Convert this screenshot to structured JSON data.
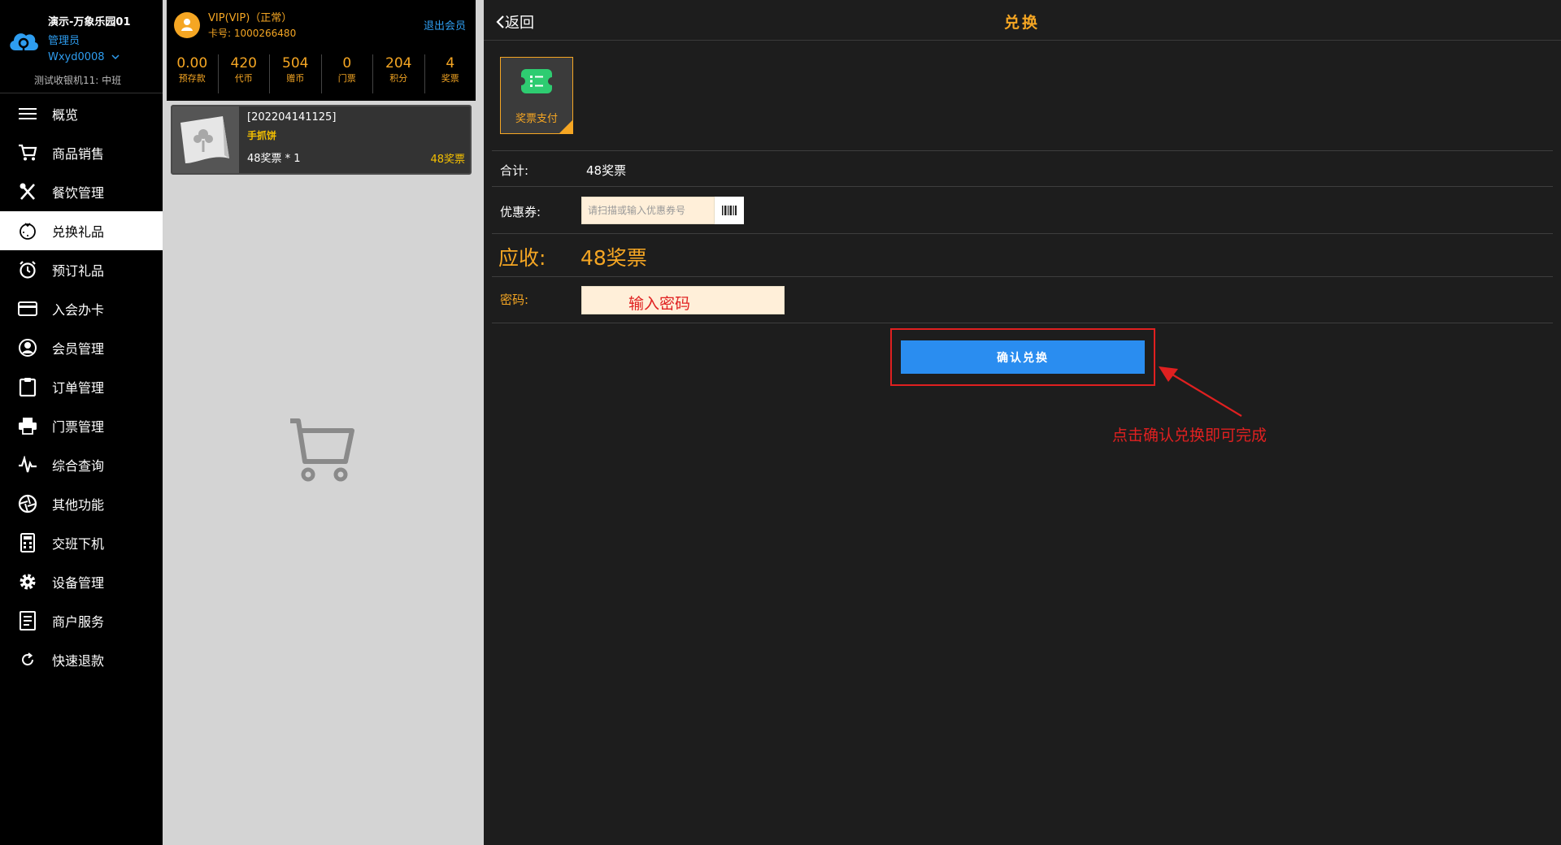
{
  "sidebar": {
    "store_name": "演示-万象乐园01",
    "role": "管理员",
    "user": "Wxyd0008",
    "terminal": "测试收银机11: 中班",
    "items": [
      {
        "label": "概览",
        "icon": "menu-icon"
      },
      {
        "label": "商品销售",
        "icon": "cart-icon"
      },
      {
        "label": "餐饮管理",
        "icon": "fork-knife-icon"
      },
      {
        "label": "兑换礼品",
        "icon": "gift-icon"
      },
      {
        "label": "预订礼品",
        "icon": "alarm-clock-icon"
      },
      {
        "label": "入会办卡",
        "icon": "card-icon"
      },
      {
        "label": "会员管理",
        "icon": "user-circle-icon"
      },
      {
        "label": "订单管理",
        "icon": "clipboard-icon"
      },
      {
        "label": "门票管理",
        "icon": "printer-icon"
      },
      {
        "label": "综合查询",
        "icon": "pulse-icon"
      },
      {
        "label": "其他功能",
        "icon": "aperture-icon"
      },
      {
        "label": "交班下机",
        "icon": "calculator-icon"
      },
      {
        "label": "设备管理",
        "icon": "gear-icon"
      },
      {
        "label": "商户服务",
        "icon": "document-icon"
      },
      {
        "label": "快速退款",
        "icon": "refresh-icon"
      }
    ]
  },
  "member": {
    "name": "VIP(VIP)（正常）",
    "card": "卡号: 1000266480",
    "exit_label": "退出会员",
    "stats": [
      {
        "value": "0.00",
        "label": "预存款"
      },
      {
        "value": "420",
        "label": "代币"
      },
      {
        "value": "504",
        "label": "赠币"
      },
      {
        "value": "0",
        "label": "门票"
      },
      {
        "value": "204",
        "label": "积分"
      },
      {
        "value": "4",
        "label": "奖票"
      }
    ]
  },
  "cart": {
    "items": [
      {
        "code": "[202204141125]",
        "name": "手抓饼",
        "qty": "48奖票 * 1",
        "price": "48奖票"
      }
    ]
  },
  "main": {
    "back_label": "返回",
    "title": "兑换",
    "pay_method": "奖票支付",
    "total_label": "合计:",
    "total_value": "48奖票",
    "coupon_label": "优惠券:",
    "coupon_placeholder": "请扫描或输入优惠券号",
    "due_label": "应收:",
    "due_value": "48奖票",
    "password_label": "密码:",
    "password_hint": "输入密码",
    "confirm_label": "确认兑换",
    "callout": "点击确认兑换即可完成"
  },
  "colors": {
    "accent": "#f5a623",
    "link": "#2e9df0",
    "primary_button": "#2a8df0",
    "annotation": "#e02020"
  }
}
